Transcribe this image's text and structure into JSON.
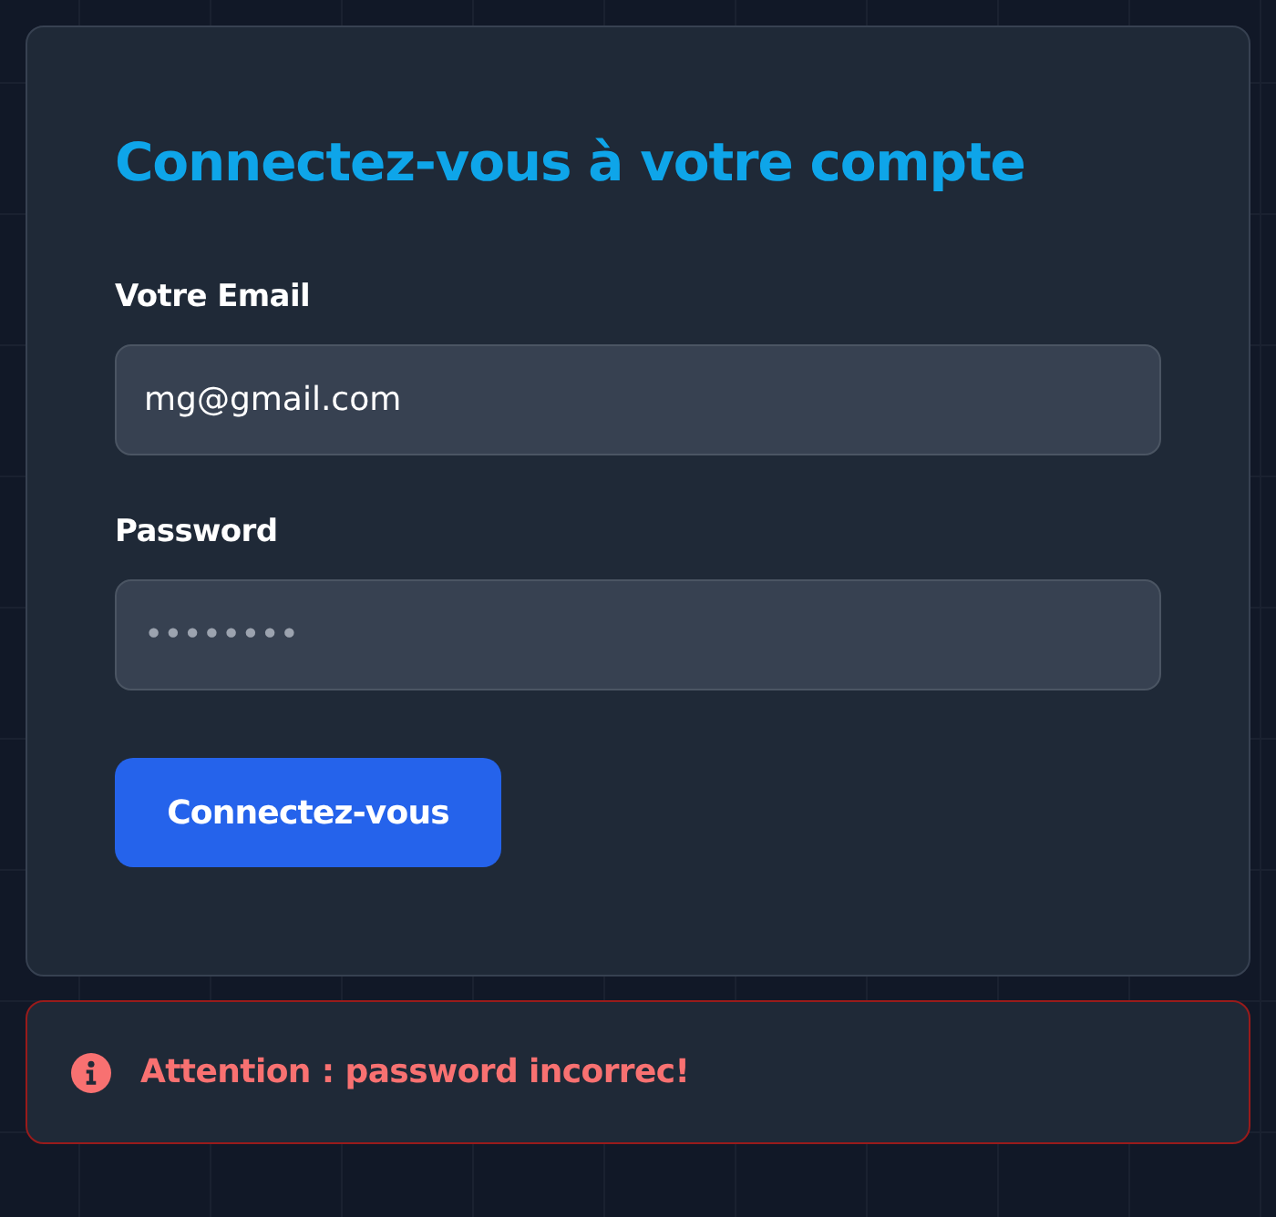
{
  "login_card": {
    "title": "Connectez-vous à votre compte",
    "fields": [
      {
        "kind": "email",
        "label": "Votre Email",
        "value": "mg@gmail.com"
      },
      {
        "kind": "password",
        "label": "Password",
        "placeholder": "••••••••"
      }
    ],
    "submit_button": "Connectez-vous"
  },
  "alert": {
    "message": "Attention : password incorrec!"
  }
}
